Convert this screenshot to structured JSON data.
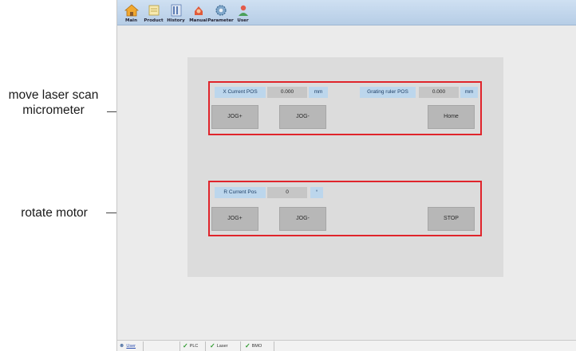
{
  "annotations": {
    "laser_line1": "move laser scan",
    "laser_line2": "micrometer",
    "motor": "rotate motor"
  },
  "toolbar": {
    "items": [
      {
        "label": "Main",
        "icon": "home-icon"
      },
      {
        "label": "Product",
        "icon": "product-icon"
      },
      {
        "label": "History",
        "icon": "history-icon"
      },
      {
        "label": "Manual",
        "icon": "manual-icon"
      },
      {
        "label": "Parameter",
        "icon": "gear-icon"
      },
      {
        "label": "User",
        "icon": "user-icon"
      }
    ]
  },
  "laser_panel": {
    "x_pos_label": "X Current POS",
    "x_pos_value": "0.000",
    "x_pos_unit": "mm",
    "grating_label": "Grating ruler POS",
    "grating_value": "0.000",
    "grating_unit": "mm",
    "jog_plus": "JOG+",
    "jog_minus": "JOG-",
    "home": "Home"
  },
  "motor_panel": {
    "r_pos_label": "R Current Pos",
    "r_pos_value": "0",
    "r_pos_unit": "°",
    "jog_plus": "JOG+",
    "jog_minus": "JOG-",
    "stop": "STOP"
  },
  "statusbar": {
    "user": "User",
    "plc": "PLC",
    "laser": "Laser",
    "bmo": "BMO"
  },
  "colors": {
    "highlight_border": "#e0242b",
    "label_bg": "#bcd6ec",
    "status_ok": "#2f9a2f"
  }
}
